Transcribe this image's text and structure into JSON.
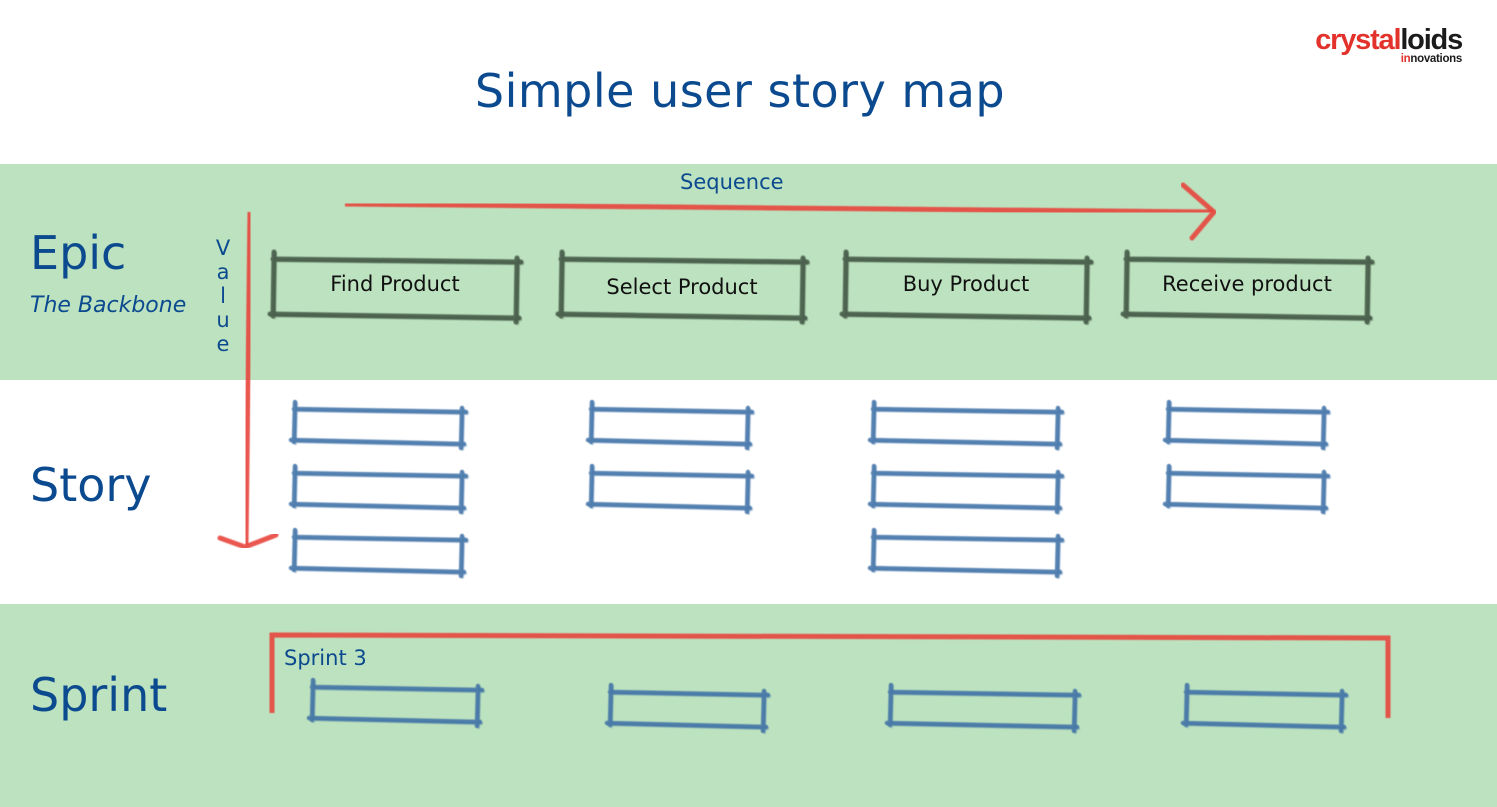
{
  "title": "Simple user story map",
  "logo": {
    "brand_part1": "crystal",
    "brand_part2": "loids",
    "tagline_part1": "in",
    "tagline_part2": "novations"
  },
  "rows": {
    "epic": {
      "label": "Epic",
      "subtitle": "The Backbone"
    },
    "story": {
      "label": "Story"
    },
    "sprint": {
      "label": "Sprint"
    }
  },
  "axes": {
    "sequence_label": "Sequence",
    "value_label": [
      "V",
      "a",
      "l",
      "u",
      "e"
    ]
  },
  "epics": [
    {
      "label": "Find Product",
      "story_count": 3,
      "sprint_count": 1
    },
    {
      "label": "Select Product",
      "story_count": 2,
      "sprint_count": 1
    },
    {
      "label": "Buy Product",
      "story_count": 3,
      "sprint_count": 1
    },
    {
      "label": "Receive product",
      "story_count": 2,
      "sprint_count": 1
    }
  ],
  "sprint": {
    "label": "Sprint 3"
  },
  "colors": {
    "title": "#0b4a8f",
    "band": "#bde2bf",
    "arrow": "#e8453c",
    "epic_card_stroke": "#3f5443",
    "story_card_stroke": "#3d6fa6",
    "logo_red": "#e3322b"
  }
}
